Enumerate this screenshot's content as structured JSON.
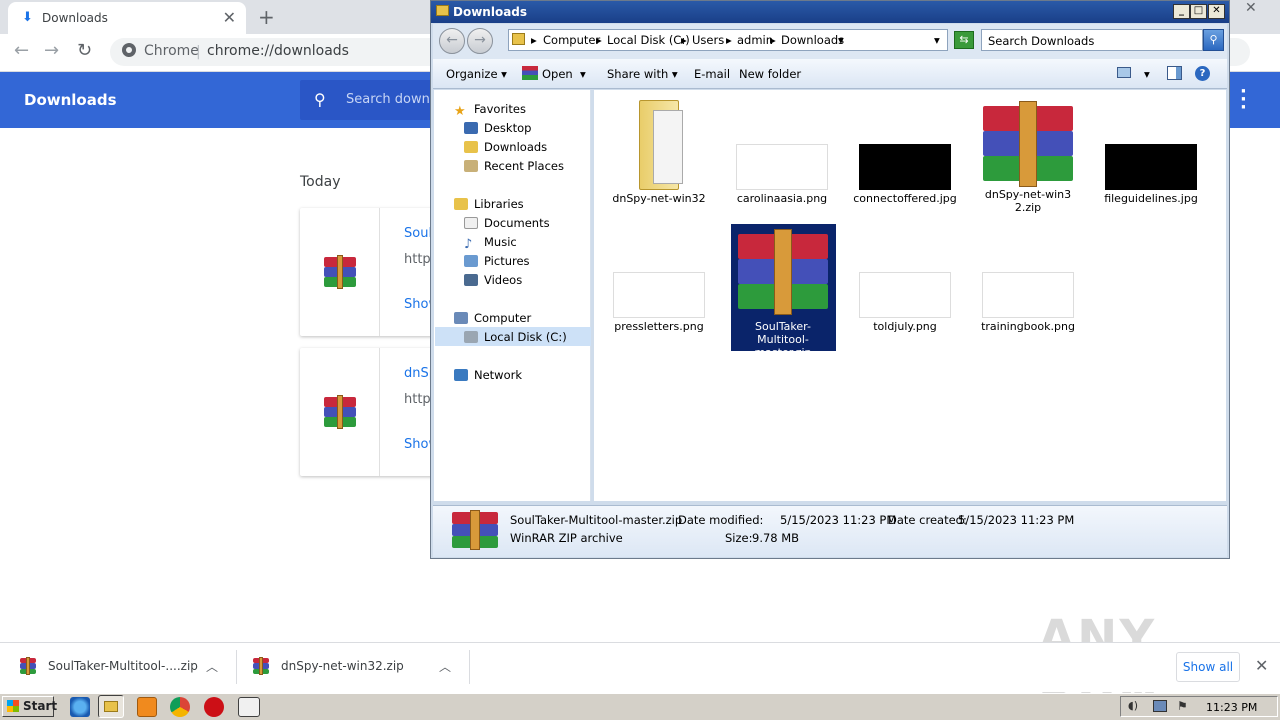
{
  "browser": {
    "tab_title": "Downloads",
    "omnibox_site": "Chrome",
    "omnibox_url": "chrome://downloads",
    "page_header": "Downloads",
    "search_placeholder": "Search downloads",
    "section_label": "Today",
    "downloads": [
      {
        "name": "Soul",
        "url": "https",
        "action": "Show"
      },
      {
        "name": "dnSp",
        "url": "https",
        "action": "Show"
      }
    ]
  },
  "shelf": {
    "items": [
      {
        "label": "SoulTaker-Multitool-....zip"
      },
      {
        "label": "dnSpy-net-win32.zip"
      }
    ],
    "show_all": "Show all"
  },
  "explorer": {
    "title": "Downloads",
    "breadcrumb": [
      "Computer",
      "Local Disk (C:)",
      "Users",
      "admin",
      "Downloads"
    ],
    "search_placeholder": "Search Downloads",
    "commands": [
      "Organize",
      "Open",
      "Share with",
      "E-mail",
      "New folder"
    ],
    "nav": {
      "favorites": "Favorites",
      "fav_items": [
        "Desktop",
        "Downloads",
        "Recent Places"
      ],
      "libraries": "Libraries",
      "lib_items": [
        "Documents",
        "Music",
        "Pictures",
        "Videos"
      ],
      "computer": "Computer",
      "comp_items": [
        "Local Disk (C:)"
      ],
      "network": "Network"
    },
    "files": [
      {
        "name": "dnSpy-net-win32",
        "kind": "folder"
      },
      {
        "name": "carolinaasia.png",
        "kind": "white"
      },
      {
        "name": "connectoffered.jpg",
        "kind": "black"
      },
      {
        "name": "dnSpy-net-win32.zip",
        "kind": "rar"
      },
      {
        "name": "fileguidelines.jpg",
        "kind": "black"
      },
      {
        "name": "pressletters.png",
        "kind": "white"
      },
      {
        "name": "SoulTaker-Multitool-master.zip",
        "kind": "rar",
        "selected": true
      },
      {
        "name": "toldjuly.png",
        "kind": "white"
      },
      {
        "name": "trainingbook.png",
        "kind": "white"
      }
    ],
    "details": {
      "name": "SoulTaker-Multitool-master.zip",
      "type": "WinRAR ZIP archive",
      "modified_label": "Date modified:",
      "modified": "5/15/2023 11:23 PM",
      "created_label": "Date created:",
      "created": "5/15/2023 11:23 PM",
      "size_label": "Size:",
      "size": "9.78 MB"
    }
  },
  "taskbar": {
    "start": "Start",
    "clock": "11:23 PM"
  },
  "watermark": "ANY RUN"
}
